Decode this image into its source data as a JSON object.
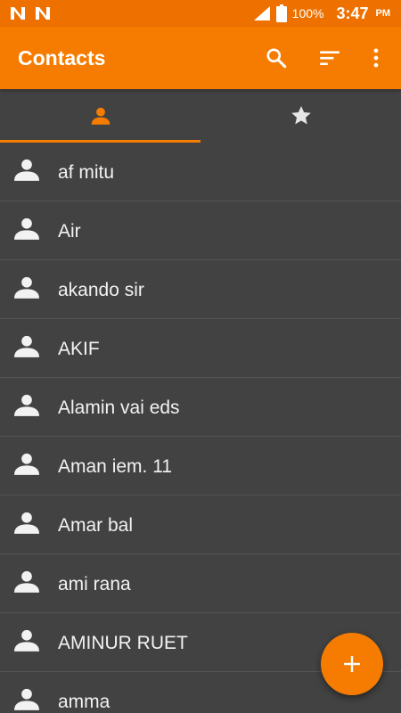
{
  "status_bar": {
    "left_icons": [
      "n-notification-icon",
      "n-notification-icon"
    ],
    "battery": "100%",
    "time": "3:47",
    "time_suffix": "PM"
  },
  "app_bar": {
    "title": "Contacts",
    "actions": [
      "search-icon",
      "sort-icon",
      "more-vert-icon"
    ]
  },
  "tabs": [
    {
      "icon": "person-icon",
      "selected": true
    },
    {
      "icon": "star-icon",
      "selected": false
    }
  ],
  "contacts": [
    {
      "name": "af mitu"
    },
    {
      "name": "Air"
    },
    {
      "name": "akando sir"
    },
    {
      "name": "AKIF"
    },
    {
      "name": "Alamin vai eds"
    },
    {
      "name": "Aman iem. 11"
    },
    {
      "name": "Amar bal"
    },
    {
      "name": "ami rana"
    },
    {
      "name": "AMINUR RUET"
    },
    {
      "name": "amma"
    }
  ],
  "fab": {
    "icon": "add-icon"
  },
  "colors": {
    "accent": "#f57c00",
    "status_bar": "#ee7100",
    "background": "#424242",
    "divider": "#555555",
    "text": "#f2f2f2"
  }
}
